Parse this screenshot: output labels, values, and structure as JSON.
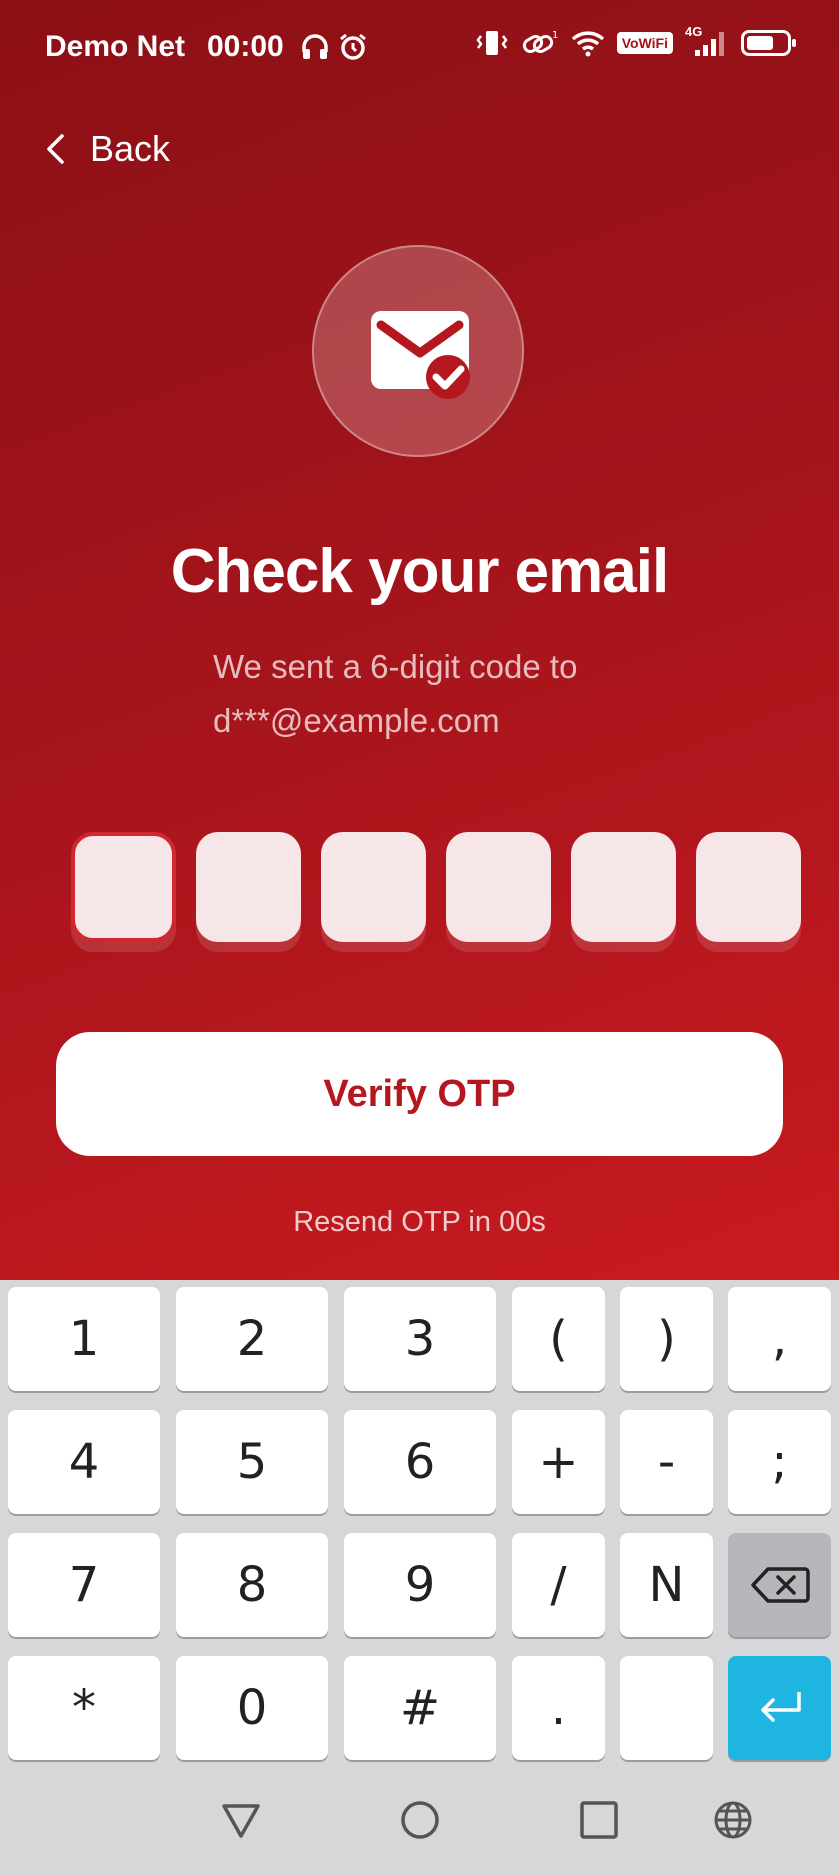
{
  "status_bar": {
    "carrier": "Demo Net",
    "time": "00:00",
    "vowifi": "VoWiFi",
    "network": "4G"
  },
  "header": {
    "back_label": "Back"
  },
  "main": {
    "title": "Check your email",
    "subtitle_line1": "We sent a 6-digit code to",
    "subtitle_line2": "d***@example.com",
    "otp_digits": [
      "",
      "",
      "",
      "",
      "",
      ""
    ],
    "verify_label": "Verify OTP",
    "resend_label": "Resend OTP in 00s"
  },
  "keyboard": {
    "row1": [
      "1",
      "2",
      "3",
      "(",
      ")",
      ","
    ],
    "row2": [
      "4",
      "5",
      "6",
      "+",
      "-",
      ";"
    ],
    "row3": [
      "7",
      "8",
      "9",
      "/",
      "N"
    ],
    "row4": [
      "*",
      "0",
      "#",
      ".",
      ""
    ]
  },
  "colors": {
    "accent": "#b5171e",
    "enter_key": "#1eb6e0",
    "background_top": "#8c1016",
    "background_bottom": "#c81a20"
  }
}
